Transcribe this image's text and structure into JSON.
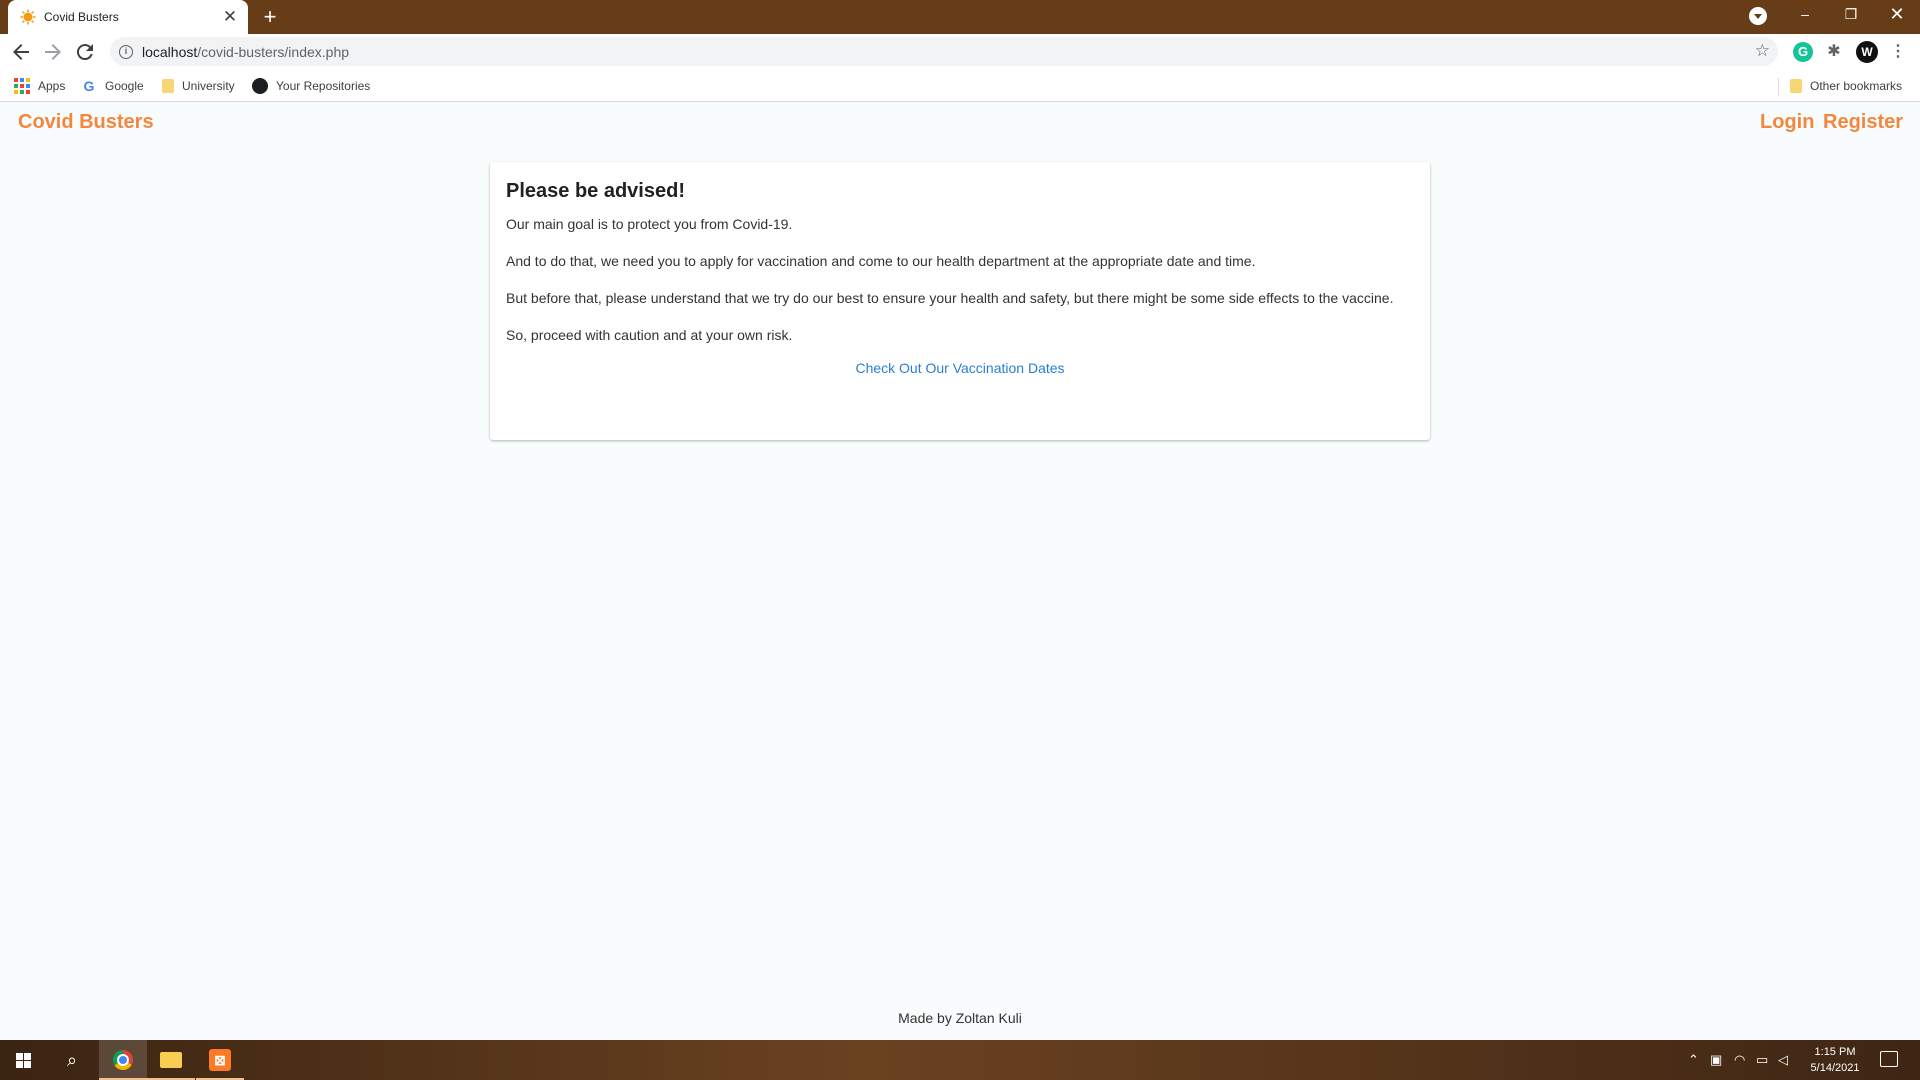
{
  "browser": {
    "tab_title": "Covid Busters",
    "tab_close": "✕",
    "new_tab": "+",
    "url_host": "localhost",
    "url_path": "/covid-busters/index.php",
    "window_min": "–",
    "window_max": "❐",
    "window_close": "✕"
  },
  "bookmarks": {
    "items": [
      "Apps",
      "Google",
      "University",
      "Your Repositories"
    ],
    "other": "Other bookmarks"
  },
  "page": {
    "brand": "Covid Busters",
    "nav_login": "Login",
    "nav_register": "Register",
    "card_title": "Please be advised!",
    "paragraphs": [
      "Our main goal is to protect you from Covid-19.",
      "And to do that, we need you to apply for vaccination and come to our health department at the appropriate date and time.",
      "But before that, please understand that we try do our best to ensure your health and safety, but there might be some side effects to the vaccine.",
      "So, proceed with caution and at your own risk."
    ],
    "cta_link": "Check Out Our Vaccination Dates",
    "footer": "Made by Zoltan Kuli"
  },
  "taskbar": {
    "time": "1:15 PM",
    "date": "5/14/2021"
  },
  "colors": {
    "accent": "#f4873f",
    "link": "#2a7fd4",
    "frame": "#663d17"
  }
}
